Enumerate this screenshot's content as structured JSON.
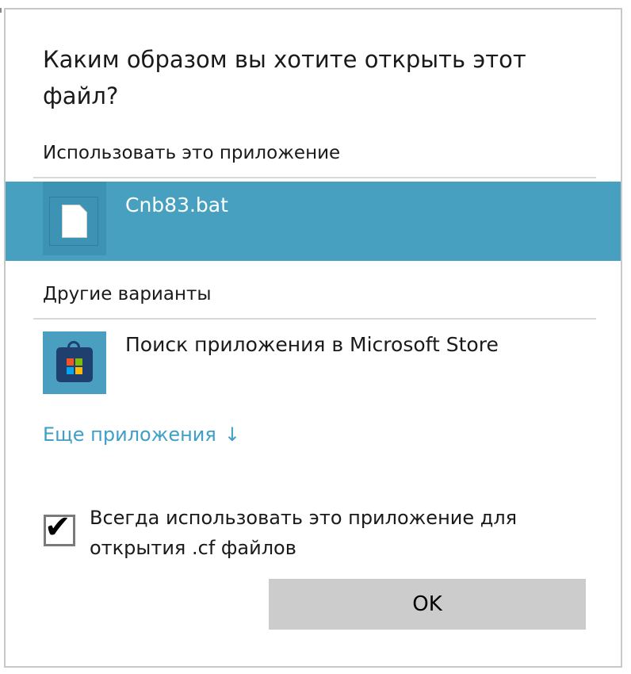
{
  "dialog": {
    "title": "Каким образом вы хотите открыть этот файл?"
  },
  "use_this_app": {
    "header": "Использовать это приложение",
    "selected_app": {
      "label": "Cnb83.bat",
      "icon": "file-icon"
    }
  },
  "other_options": {
    "header": "Другие варианты",
    "store_app": {
      "label": "Поиск приложения в Microsoft Store",
      "icon": "microsoft-store-icon"
    },
    "more_apps_label": "Еще приложения",
    "more_apps_arrow": "↓"
  },
  "always_use": {
    "checked": true,
    "check_glyph": "✔",
    "label": "Всегда использовать это приложение для открытия .cf файлов"
  },
  "ok_button": {
    "label": "OK"
  },
  "colors": {
    "selection": "#47a0c0",
    "link": "#3f9fc6",
    "button": "#cccccc",
    "divider": "#d9d9d9"
  }
}
